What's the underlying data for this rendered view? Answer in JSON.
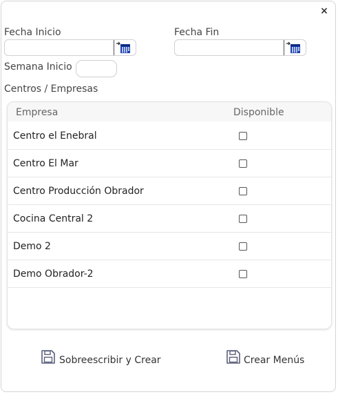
{
  "dialog": {
    "close_glyph": "×"
  },
  "fields": {
    "fecha_inicio_label": "Fecha Inicio",
    "fecha_inicio_value": "",
    "fecha_fin_label": "Fecha Fin",
    "fecha_fin_value": "",
    "semana_inicio_label": "Semana Inicio",
    "semana_inicio_value": ""
  },
  "section": {
    "centros_label": "Centros / Empresas"
  },
  "grid": {
    "columns": [
      "Empresa",
      "Disponible"
    ],
    "rows": [
      {
        "empresa": "Centro el Enebral",
        "disponible": false
      },
      {
        "empresa": "Centro El Mar",
        "disponible": false
      },
      {
        "empresa": "Centro Producción Obrador",
        "disponible": false
      },
      {
        "empresa": "Cocina Central 2",
        "disponible": false
      },
      {
        "empresa": "Demo 2",
        "disponible": false
      },
      {
        "empresa": "Demo Obrador-2",
        "disponible": false
      }
    ]
  },
  "actions": {
    "overwrite_label": "Sobreescribir y Crear",
    "create_label": "Crear Menús"
  },
  "icons": [
    "close-icon",
    "calendar-icon",
    "floppy-disk-icon"
  ],
  "colors": {
    "calendar_accent": "#1a3fb0",
    "border": "#d0d0d0"
  }
}
